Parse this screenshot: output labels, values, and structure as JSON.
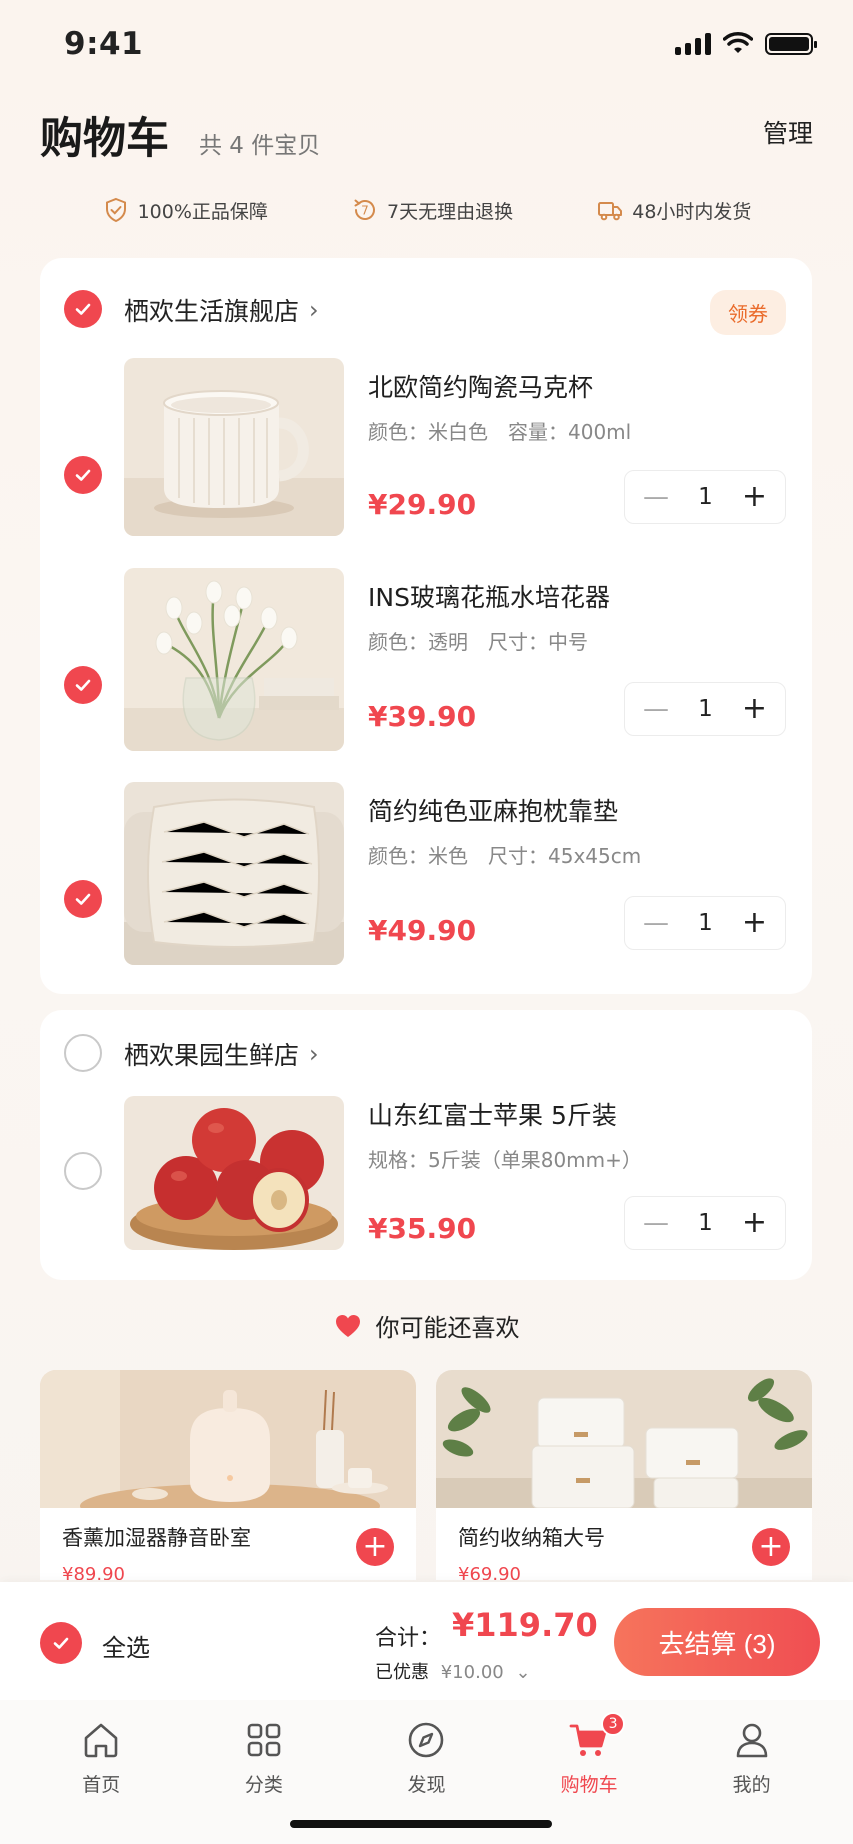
{
  "status": {
    "time": "9:41"
  },
  "header": {
    "title": "购物车",
    "count": "共 4 件宝贝",
    "manage": "管理"
  },
  "guarantees": [
    {
      "icon": "shield-check-icon",
      "label": "100%正品保障"
    },
    {
      "icon": "seven-day-return-icon",
      "label": "7天无理由退换",
      "badge": "7"
    },
    {
      "icon": "truck-icon",
      "label": "48小时内发货"
    }
  ],
  "stores": [
    {
      "name": "栖欢生活旗舰店",
      "coupon": "领券",
      "items": [
        {
          "title": "北欧简约陶瓷马克杯",
          "spec": "颜色：米白色　容量：400ml",
          "price": "¥29.90",
          "qty": "1"
        },
        {
          "title": "INS玻璃花瓶水培花器",
          "spec": "颜色：透明　尺寸：中号",
          "price": "¥39.90",
          "qty": "1"
        },
        {
          "title": "简约纯色亚麻抱枕靠垫",
          "spec": "颜色：米色　尺寸：45x45cm",
          "price": "¥49.90",
          "qty": "1"
        }
      ]
    },
    {
      "name": "栖欢果园生鲜店",
      "items": [
        {
          "title": "山东红富士苹果 5斤装",
          "spec": "规格：5斤装（单果80mm+）",
          "price": "¥35.90",
          "qty": "1"
        }
      ]
    }
  ],
  "recommend": {
    "title": "你可能还喜欢",
    "items": [
      {
        "title": "香薰加湿器静音卧室",
        "price": "¥89.90"
      },
      {
        "title": "简约收纳箱大号",
        "price": "¥69.90"
      }
    ]
  },
  "checkout": {
    "select_all": "全选",
    "total_label": "合计：",
    "total": "¥119.70",
    "discount_label": "已优惠",
    "discount": "¥10.00",
    "button": "去结算 (3)"
  },
  "tabs": [
    {
      "label": "首页",
      "icon": "home-icon"
    },
    {
      "label": "分类",
      "icon": "grid-icon"
    },
    {
      "label": "发现",
      "icon": "compass-icon"
    },
    {
      "label": "购物车",
      "icon": "cart-icon",
      "badge": "3",
      "active": true
    },
    {
      "label": "我的",
      "icon": "user-icon"
    }
  ],
  "colors": {
    "accent": "#f0474f",
    "coupon": "#ea6b2b",
    "background": "#fbf4ee"
  }
}
